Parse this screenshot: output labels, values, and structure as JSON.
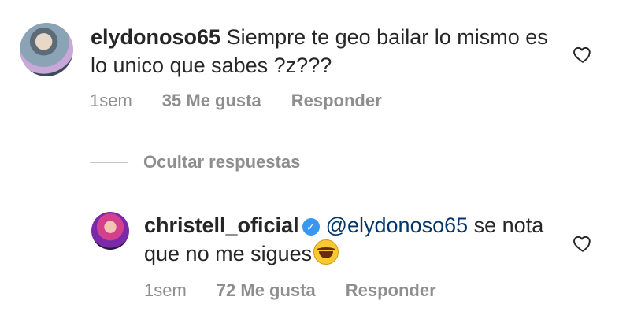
{
  "comment": {
    "username": "elydonoso65",
    "text": "Siempre te geo bailar lo mismo es lo unico que sabes ?z???",
    "time": "1sem",
    "likes": "35 Me gusta",
    "reply_label": "Responder"
  },
  "replies_toggle": {
    "label": "Ocultar respuestas"
  },
  "reply": {
    "username": "christell_oficial",
    "mention": "@elydonoso65",
    "text": " se nota que no me sigues",
    "emoji": "face-with-tears-of-joy",
    "time": "1sem",
    "likes": "72 Me gusta",
    "reply_label": "Responder"
  },
  "colors": {
    "text": "#262626",
    "meta": "#8e8e8e",
    "mention": "#00376b",
    "verified": "#3897f0"
  }
}
